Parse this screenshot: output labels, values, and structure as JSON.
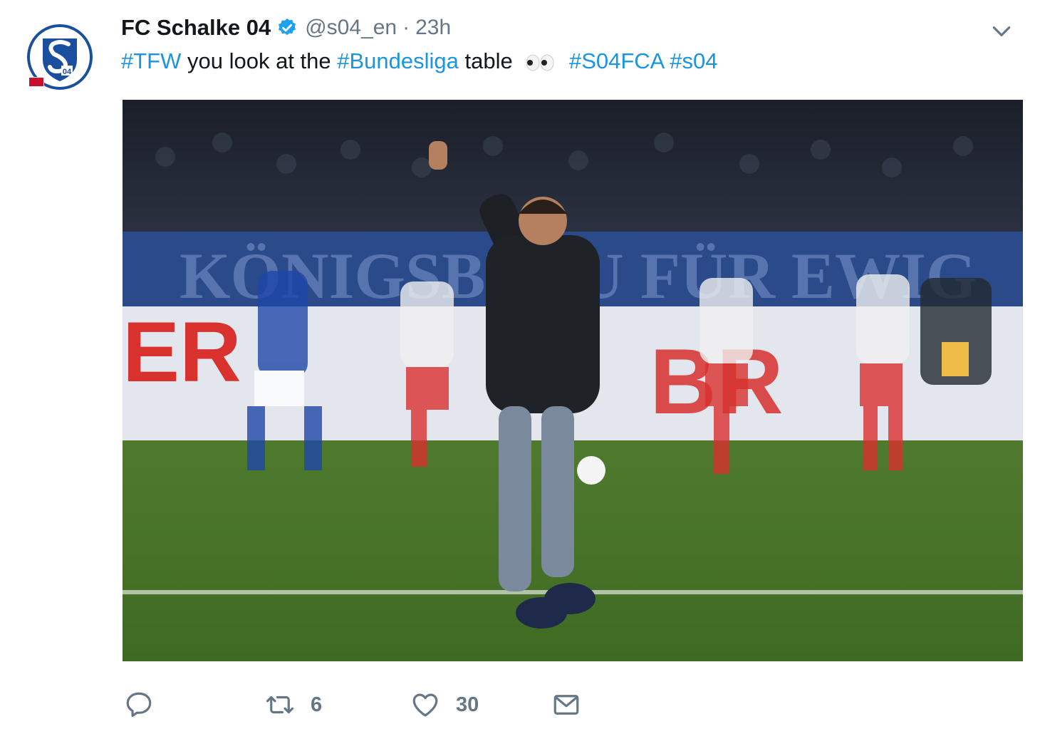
{
  "tweet": {
    "display_name": "FC Schalke 04",
    "handle": "@s04_en",
    "separator": "·",
    "time": "23h",
    "text_parts": [
      {
        "text": "#TFW",
        "type": "hashtag"
      },
      {
        "text": " you look at the ",
        "type": "plain"
      },
      {
        "text": "#Bundesliga",
        "type": "hashtag"
      },
      {
        "text": " table ",
        "type": "plain"
      },
      {
        "text": " #S04FCA",
        "type": "hashtag"
      },
      {
        "text": " #s04",
        "type": "hashtag"
      }
    ],
    "media": {
      "banner_text": "KÖNIGSBLAU FÜR EWIG",
      "ad_text_left": "ER",
      "ad_text_center": "BR"
    },
    "actions": {
      "retweet_count": "6",
      "like_count": "30"
    }
  },
  "icons": {
    "avatar": "schalke-logo",
    "verified": "verified-badge-icon",
    "chevron": "chevron-down-icon",
    "reply": "reply-icon",
    "retweet": "retweet-icon",
    "like": "heart-icon",
    "dm": "envelope-icon",
    "eyes": "eyes-emoji-icon"
  },
  "colors": {
    "link": "#1b95e0",
    "text": "#14171a",
    "secondary": "#657786",
    "schalke_blue": "#1a4fa0"
  }
}
